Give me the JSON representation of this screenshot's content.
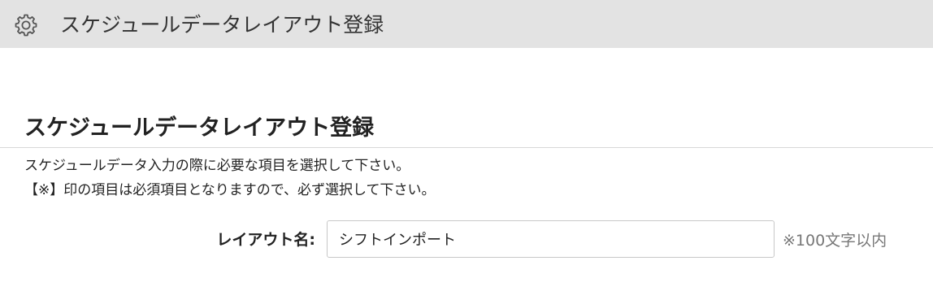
{
  "header": {
    "icon": "gear-icon",
    "title": "スケジュールデータレイアウト登録",
    "background": "#e3e3e3"
  },
  "main": {
    "heading": "スケジュールデータレイアウト登録",
    "description_line1": "スケジュールデータ入力の際に必要な項目を選択して下さい。",
    "description_line2": "【※】印の項目は必須項目となりますので、必ず選択して下さい。"
  },
  "form": {
    "layout_name_label": "レイアウト名:",
    "layout_name_value": "シフトインポート",
    "layout_name_note": "※100文字以内"
  }
}
